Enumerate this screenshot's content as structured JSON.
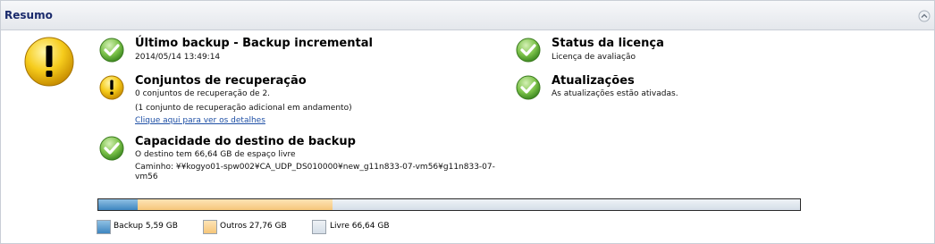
{
  "panel": {
    "title": "Resumo"
  },
  "items": {
    "backup": {
      "title": "Último backup - Backup incremental",
      "line1": "2014/05/14 13:49:14"
    },
    "recovery": {
      "title": "Conjuntos de recuperação",
      "line1": "0 conjuntos de recuperação de 2.",
      "line2": "(1 conjunto de recuperação adicional em andamento)",
      "link": "Clique aqui para ver os detalhes"
    },
    "capacity": {
      "title": "Capacidade do destino de backup",
      "line1": "O destino tem 66,64 GB de espaço livre",
      "line2": "Caminho: ¥¥kogyo01-spw002¥CA_UDP_DS010000¥new_g11n833-07-vm56¥g11n833-07-vm56"
    },
    "license": {
      "title": "Status da licença",
      "line1": "Licença de avaliação"
    },
    "updates": {
      "title": "Atualizações",
      "line1": "As atualizações estão ativadas."
    }
  },
  "capacity_bar": {
    "backup_gb": 5.59,
    "outros_gb": 27.76,
    "livre_gb": 66.64
  },
  "legend": {
    "backup": "Backup 5,59 GB",
    "outros": "Outros 27,76 GB",
    "livre": "Livre 66,64 GB"
  },
  "colors": {
    "ok": "#5aa532",
    "warning": "#f2c618",
    "backup": "#3e86c0",
    "outros": "#f6c67a",
    "livre": "#d5dee8",
    "header_text": "#1a2a6c",
    "link": "#1e4fa5"
  },
  "icons": {
    "overall": "warning-icon",
    "backup": "check-icon",
    "recovery": "warning-icon",
    "capacity": "check-icon",
    "license": "check-icon",
    "updates": "check-icon"
  }
}
